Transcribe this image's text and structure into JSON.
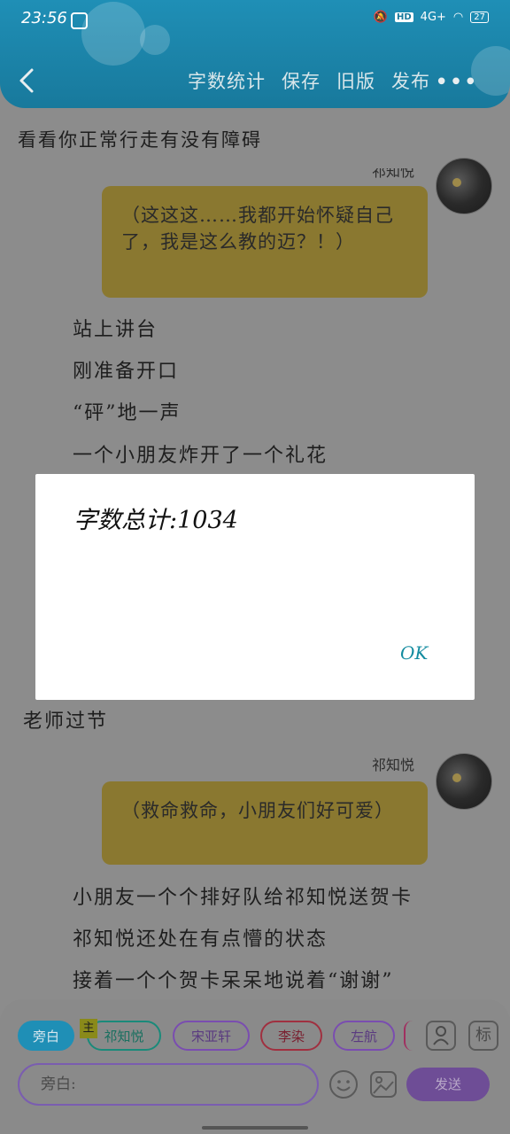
{
  "status_bar": {
    "time": "23:56",
    "hd": "HD",
    "network": "4G+",
    "battery": "27"
  },
  "header": {
    "menu": [
      "字数统计",
      "保存",
      "旧版",
      "发布"
    ]
  },
  "content": {
    "first_line": "看看你正常行走有没有障碍",
    "top_speaker_name": "祁知悦",
    "note1": "（这这这……我都开始怀疑自己了，我是这么教的迈？！）",
    "lines1": [
      "站上讲台",
      "刚准备开口",
      "“砰”地一声",
      "一个小朋友炸开了一个礼花"
    ],
    "teacher_line": "老师过节",
    "speaker2": "祁知悦",
    "note2": "（救命救命，小朋友们好可爱）",
    "lines2": [
      "小朋友一个个排好队给祁知悦送贺卡",
      "祁知悦还处在有点懵的状态",
      "接着一个个贺卡呆呆地说着“谢谢”"
    ]
  },
  "dialog": {
    "text": "字数总计:1034",
    "ok": "OK"
  },
  "bottom_bar": {
    "chips": [
      "旁白",
      "祁知悦",
      "宋亚轩",
      "李染",
      "左航"
    ],
    "main_badge": "主",
    "input_placeholder": "旁白:",
    "send": "发送",
    "tag_icon_label": "标"
  },
  "colors": {
    "header": "#1f8fb6",
    "note": "#8a7830",
    "chip_active": "#1f8fb6",
    "ok": "#148ca0",
    "send": "#6e4d96"
  }
}
